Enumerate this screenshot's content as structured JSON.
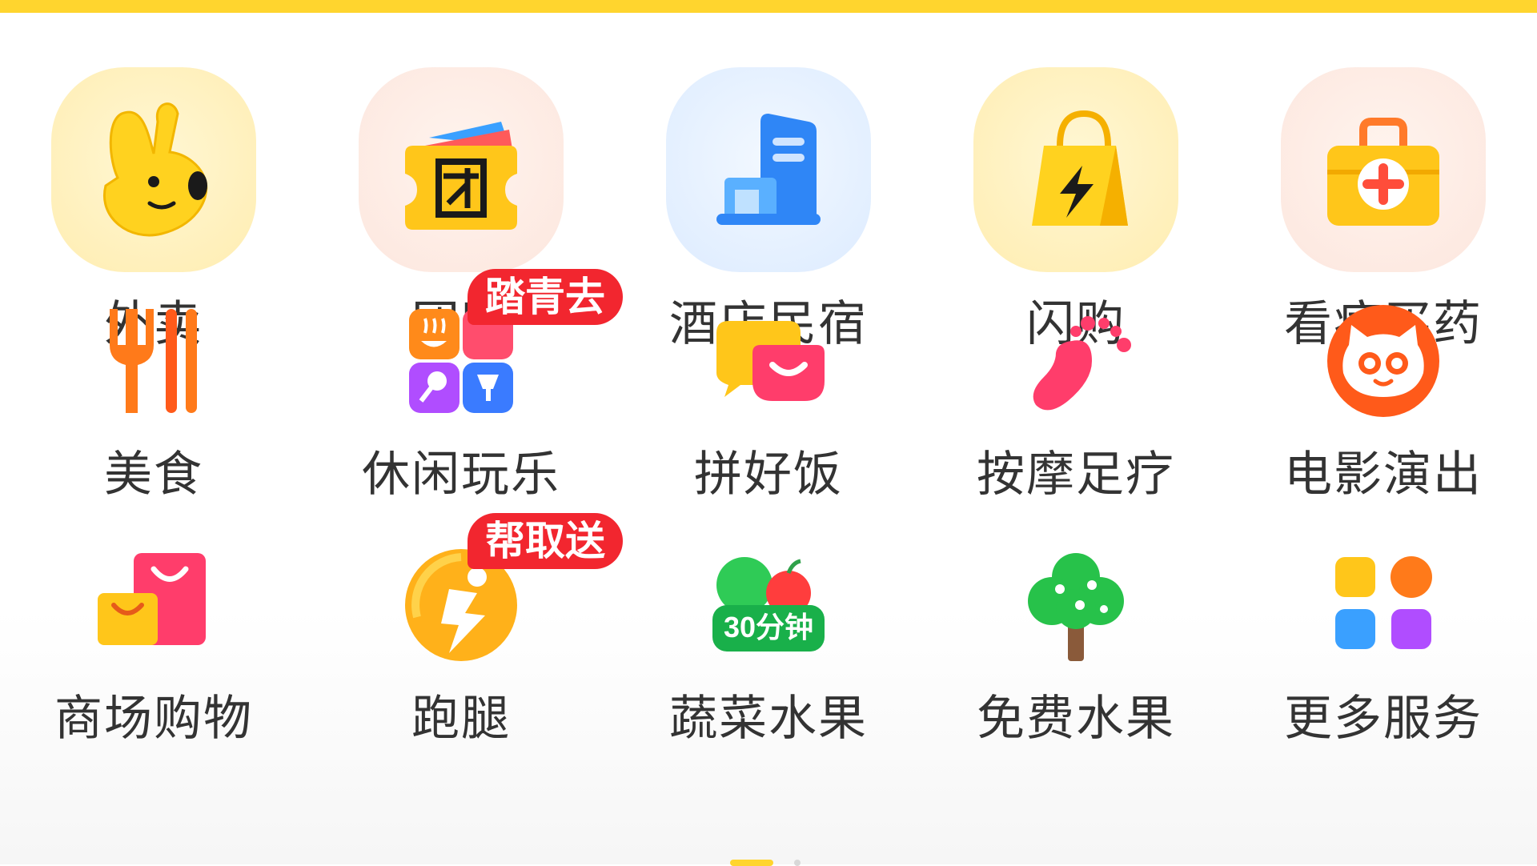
{
  "services": {
    "waimai": {
      "label": "外卖",
      "icon": "rabbit-mascot-icon"
    },
    "tuangou": {
      "label": "团购",
      "icon": "group-buy-ticket-icon"
    },
    "jiudian": {
      "label": "酒店民宿",
      "icon": "hotel-building-icon"
    },
    "shangou": {
      "label": "闪购",
      "icon": "lightning-bag-icon"
    },
    "yiyao": {
      "label": "看病买药",
      "icon": "medical-kit-icon"
    },
    "meishi": {
      "label": "美食",
      "icon": "fork-chopsticks-icon"
    },
    "xiuxian": {
      "label": "休闲玩乐",
      "icon": "leisure-grid-icon",
      "badge": "踏青去"
    },
    "pinhaofan": {
      "label": "拼好饭",
      "icon": "bowl-smile-icon"
    },
    "anmo": {
      "label": "按摩足疗",
      "icon": "foot-icon"
    },
    "dianying": {
      "label": "电影演出",
      "icon": "cat-face-icon"
    },
    "shangchang": {
      "label": "商场购物",
      "icon": "shopping-bags-icon"
    },
    "paotui": {
      "label": "跑腿",
      "icon": "runner-bolt-icon",
      "badge": "帮取送"
    },
    "shucai": {
      "label": "蔬菜水果",
      "icon": "vegetables-fruit-icon",
      "icon_text": "30分钟"
    },
    "mianfei": {
      "label": "免费水果",
      "icon": "tree-icon"
    },
    "gengduo": {
      "label": "更多服务",
      "icon": "more-services-icon"
    }
  },
  "colors": {
    "brand": "#FFD52E",
    "badge": "#F2262F",
    "label": "#333333"
  }
}
